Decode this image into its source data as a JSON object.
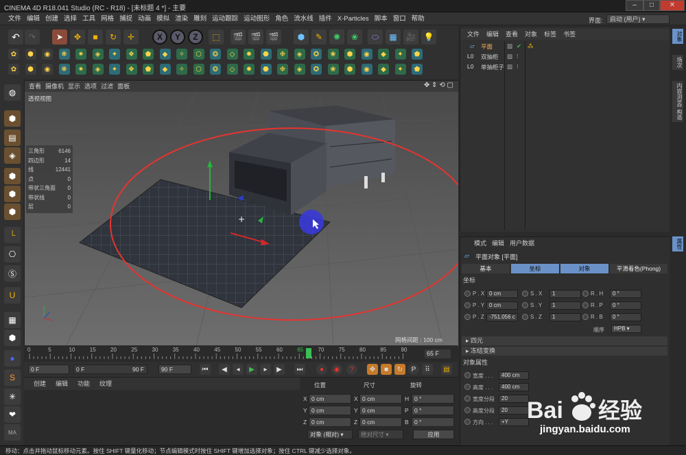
{
  "window": {
    "title": "CINEMA 4D R18.041 Studio (RC - R18) - [未标题 4 *] - 主要",
    "min": "–",
    "max": "□",
    "close": "✕"
  },
  "menu": [
    "文件",
    "编辑",
    "创建",
    "选择",
    "工具",
    "网格",
    "捕捉",
    "动画",
    "模拟",
    "渲染",
    "雕刻",
    "运动跟踪",
    "运动图形",
    "角色",
    "流水线",
    "插件",
    "X-Particles",
    "脚本",
    "窗口",
    "帮助"
  ],
  "layout": {
    "label": "界面:",
    "value": "启动 (用户)"
  },
  "toolbar": {
    "x": "X",
    "y": "Y",
    "z": "Z"
  },
  "viewport": {
    "menu": [
      "查看",
      "摄像机",
      "显示",
      "选项",
      "过滤",
      "面板"
    ],
    "label": "透视视图",
    "grid_distance": "网格间距 : 100 cm",
    "stats": [
      {
        "k": "三角形",
        "v": "6146"
      },
      {
        "k": "四边形",
        "v": "14"
      },
      {
        "k": "线",
        "v": "12441"
      },
      {
        "k": "点",
        "v": "0"
      },
      {
        "k": "带状三角面",
        "v": "0"
      },
      {
        "k": "带状线",
        "v": "0"
      },
      {
        "k": "层",
        "v": "0"
      }
    ]
  },
  "timeline": {
    "ticks": [
      "0",
      "5",
      "10",
      "15",
      "20",
      "25",
      "30",
      "35",
      "40",
      "45",
      "50",
      "55",
      "60",
      "65",
      "70",
      "75",
      "80",
      "85",
      "90"
    ],
    "current": "65",
    "frame_end": "65 F",
    "start": "0 F",
    "min": "0 F",
    "max": "90 F",
    "end": "90 F"
  },
  "material": {
    "menu": [
      "创建",
      "编辑",
      "功能",
      "纹理"
    ]
  },
  "coords": {
    "headers": [
      "位置",
      "尺寸",
      "旋转"
    ],
    "rows": [
      {
        "a": "X",
        "pos": "0 cm",
        "b": "X",
        "size": "0 cm",
        "c": "H",
        "rot": "0 °"
      },
      {
        "a": "Y",
        "pos": "0 cm",
        "b": "Y",
        "size": "0 cm",
        "c": "P",
        "rot": "0 °"
      },
      {
        "a": "Z",
        "pos": "0 cm",
        "b": "Z",
        "size": "0 cm",
        "c": "B",
        "rot": "0 °"
      }
    ],
    "mode": "对象 (相对)",
    "size_mode": "绝对尺寸",
    "apply": "应用"
  },
  "objects": {
    "menu": [
      "文件",
      "编辑",
      "查看",
      "对象",
      "标签",
      "书签"
    ],
    "items": [
      {
        "name": "平面"
      },
      {
        "name": "双抽柜"
      },
      {
        "name": "单抽柜子"
      }
    ]
  },
  "attributes": {
    "menu": [
      "模式",
      "编辑",
      "用户数据"
    ],
    "object_title": "平面对象 [平面]",
    "tabs": [
      "基本",
      "坐标",
      "对象",
      "平滑着色(Phong)"
    ],
    "section_coords": "坐标",
    "coord_rows": [
      {
        "p": "P . X",
        "pv": "0 cm",
        "s": "S . X",
        "sv": "1",
        "r": "R . H",
        "rv": "0 °"
      },
      {
        "p": "P . Y",
        "pv": "0 cm",
        "s": "S . Y",
        "sv": "1",
        "r": "R . P",
        "rv": "0 °"
      },
      {
        "p": "P . Z",
        "pv": "-751.056 c",
        "s": "S . Z",
        "sv": "1",
        "r": "R . B",
        "rv": "0 °"
      }
    ],
    "order_label": "顺序",
    "order_value": "HPB",
    "sec_quat": "四元",
    "sec_freeze": "冻结变换",
    "sec_objprops": "对象属性",
    "props": [
      {
        "k": "宽度 . . .",
        "v": "400 cm"
      },
      {
        "k": "高度 . . .",
        "v": "400 cm"
      },
      {
        "k": "宽度分段",
        "v": "20"
      },
      {
        "k": "高度分段",
        "v": "20"
      },
      {
        "k": "方向 . . .",
        "v": "+Y"
      }
    ]
  },
  "sidetabs": [
    "对象",
    "场次",
    "内容浏览器",
    "构造"
  ],
  "attr_sidetab": "属性",
  "status": "移动：点击并拖动鼠标移动元素。按住 SHIFT 键量化移动；节点编辑模式时按住 SHIFT 键增加选择对象；按住 CTRL 键减少选择对象。",
  "watermark": {
    "brand": "Bai",
    "brand2": "经验",
    "url": "jingyan.baidu.com"
  },
  "colors": {
    "annotation": "#e8332f",
    "accent": "#6a92c8"
  }
}
